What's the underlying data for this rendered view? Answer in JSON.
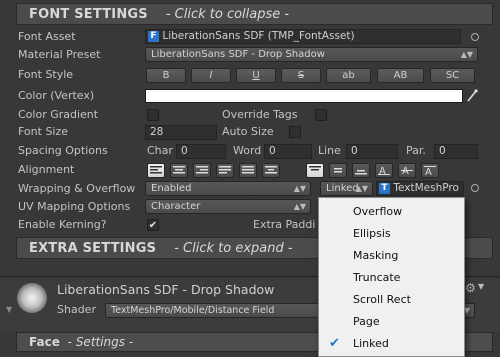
{
  "font_settings": {
    "title": "FONT SETTINGS",
    "hint": "- Click to collapse -",
    "font_asset": {
      "label": "Font Asset",
      "value": "LiberationSans SDF (TMP_FontAsset)",
      "icon": "font-asset-icon"
    },
    "material_preset": {
      "label": "Material Preset",
      "value": "LiberationSans SDF - Drop Shadow"
    },
    "font_style": {
      "label": "Font Style",
      "buttons": [
        "B",
        "I",
        "U",
        "S",
        "ab",
        "AB",
        "SC"
      ]
    },
    "color": {
      "label": "Color (Vertex)",
      "value": "#ffffff"
    },
    "color_gradient": {
      "label": "Color Gradient"
    },
    "override_tags": {
      "label": "Override Tags"
    },
    "font_size": {
      "label": "Font Size",
      "value": "28"
    },
    "auto_size": {
      "label": "Auto Size"
    },
    "spacing": {
      "label": "Spacing Options",
      "char_label": "Char",
      "char_value": "0",
      "word_label": "Word",
      "word_value": "0",
      "line_label": "Line",
      "line_value": "0",
      "par_label": "Par.",
      "par_value": "0"
    },
    "alignment": {
      "label": "Alignment"
    },
    "wrapping": {
      "label": "Wrapping & Overflow",
      "value": "Enabled",
      "overflow_value": "Linked",
      "linked_object": "TextMeshPro"
    },
    "uv_mapping": {
      "label": "UV Mapping Options",
      "value": "Character"
    },
    "kerning": {
      "label": "Enable Kerning?",
      "checked": true
    },
    "extra_padding": {
      "label": "Extra Paddi"
    }
  },
  "extra_settings": {
    "title": "EXTRA SETTINGS",
    "hint": "- Click to expand -"
  },
  "material": {
    "name": "LiberationSans SDF - Drop Shadow",
    "shader_label": "Shader",
    "shader_value": "TextMeshPro/Mobile/Distance Field"
  },
  "face": {
    "title": "Face",
    "hint": "- Settings -"
  },
  "overflow_menu": {
    "items": [
      "Overflow",
      "Ellipsis",
      "Masking",
      "Truncate",
      "Scroll Rect",
      "Page",
      "Linked"
    ],
    "selected": "Linked"
  }
}
